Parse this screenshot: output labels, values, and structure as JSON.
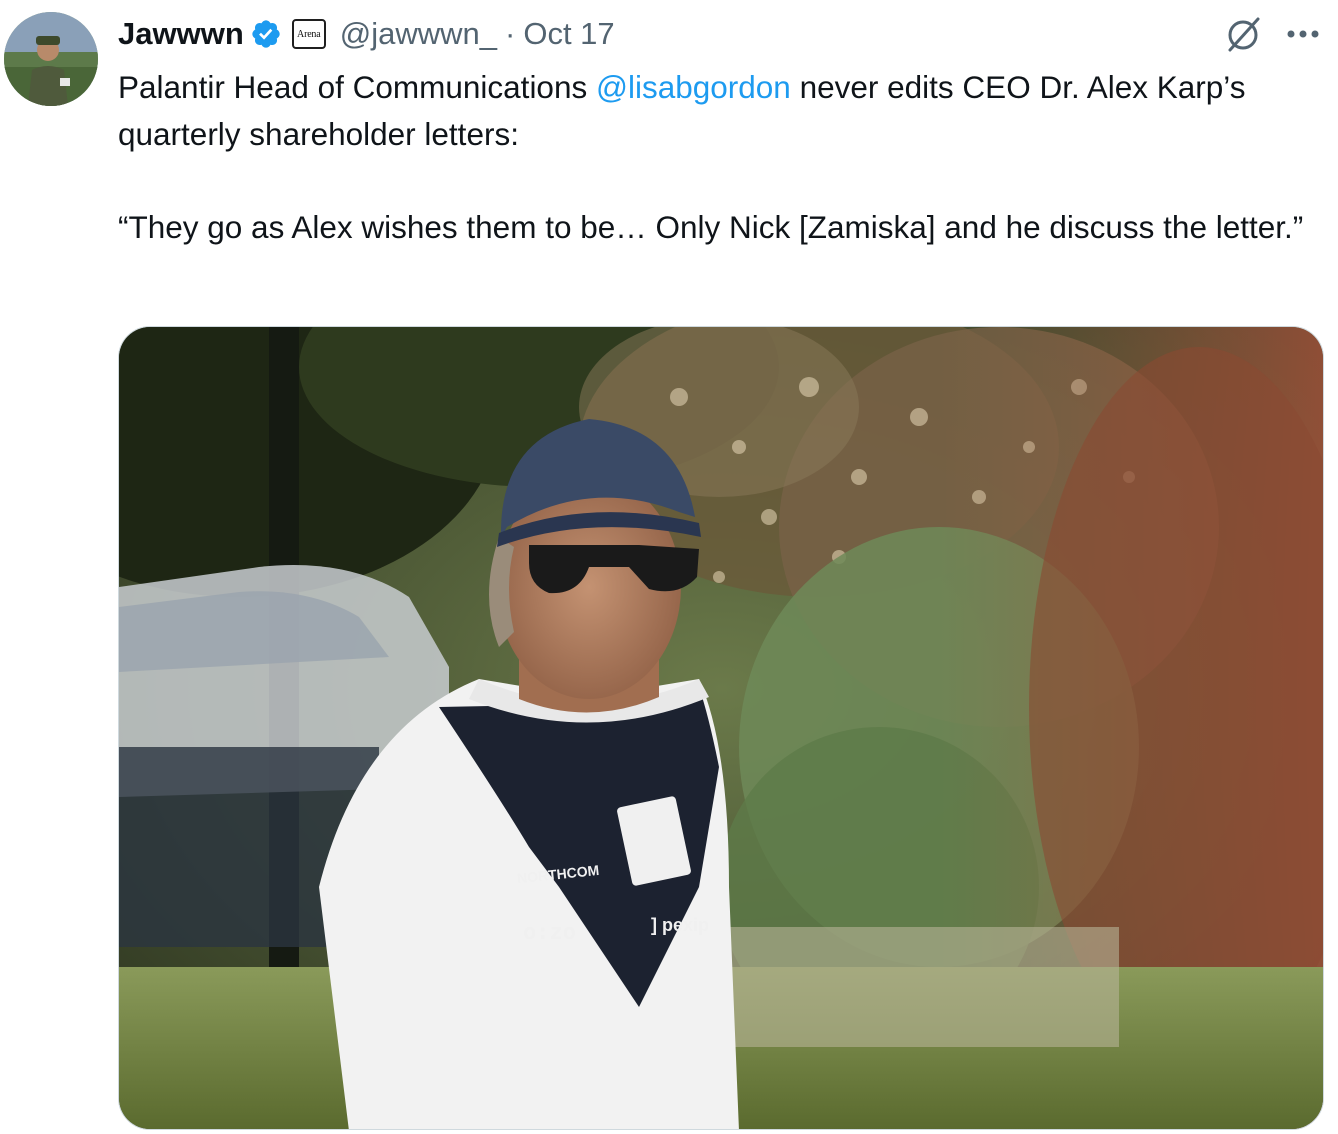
{
  "author": {
    "display_name": "Jawwwn",
    "handle": "@jawwwn_",
    "affiliate_badge": "Arena",
    "verified_icon": "verified-badge-icon",
    "avatar_icon": "profile-photo"
  },
  "tweet": {
    "separator": "·",
    "timestamp": "Oct 17",
    "text_before_mention": "Palantir Head of Communications ",
    "mention": "@lisabgordon",
    "text_after_mention": " never edits CEO Dr. Alex Karp’s quarterly shareholder letters:",
    "quote": "“They go as Alex wishes them to be… Only Nick [Zamiska] and he discuss the letter.”",
    "media_shirt_text": {
      "brand1": "NORTHCOM",
      "brand2": "o:zo",
      "brand3": "] pexip"
    }
  },
  "actions": {
    "grok_icon": "grok-icon",
    "more_icon": "more-options-icon"
  },
  "colors": {
    "text": "#0f1419",
    "secondary": "#536471",
    "link": "#1d9bf0",
    "verified": "#1d9bf0"
  }
}
